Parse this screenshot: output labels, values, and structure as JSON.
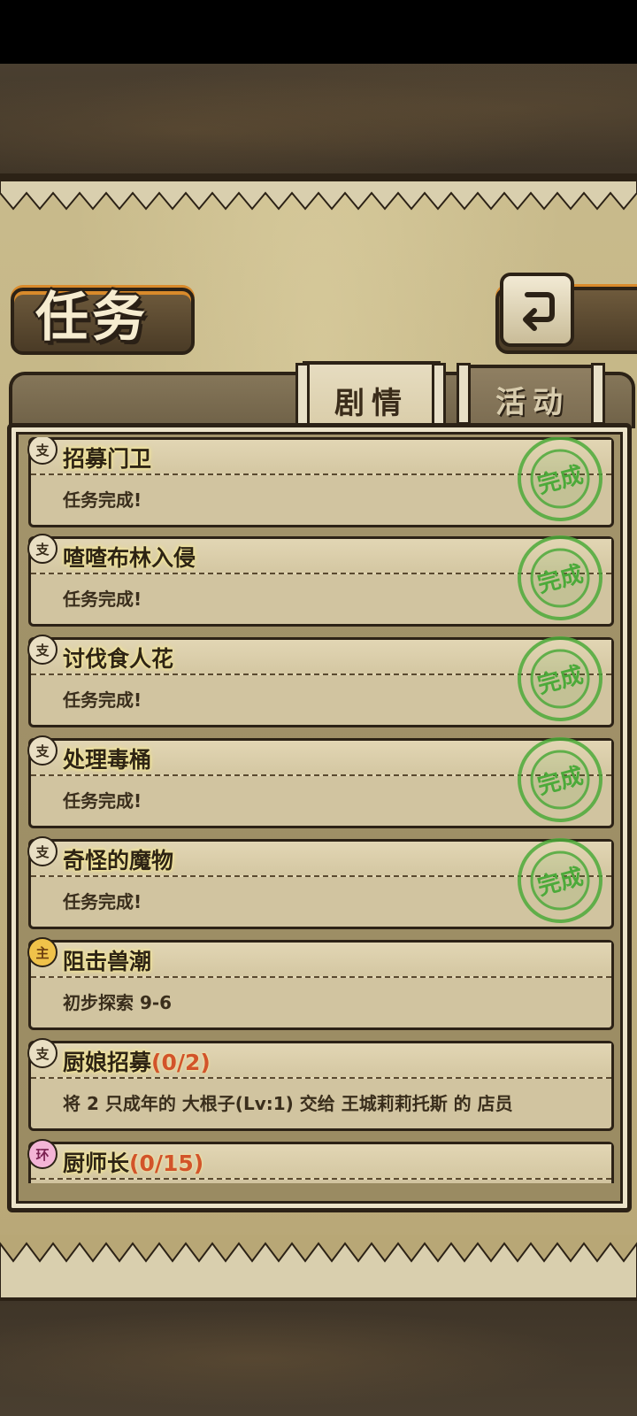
{
  "page_title": "任务",
  "tabs": [
    {
      "label": "剧情",
      "active": true
    },
    {
      "label": "活动",
      "active": false
    }
  ],
  "back_icon": "back-arrow-icon",
  "stamp": {
    "text": "完成",
    "ring_text": "Mission Complete Mission Complete",
    "color": "#4caa3a"
  },
  "quests": [
    {
      "badge": "支",
      "type": "side",
      "title": "招募门卫",
      "progress": "",
      "desc": "任务完成!",
      "completed": true
    },
    {
      "badge": "支",
      "type": "side",
      "title": "喳喳布林入侵",
      "progress": "",
      "desc": "任务完成!",
      "completed": true
    },
    {
      "badge": "支",
      "type": "side",
      "title": "讨伐食人花",
      "progress": "",
      "desc": "任务完成!",
      "completed": true
    },
    {
      "badge": "支",
      "type": "side",
      "title": "处理毒桶",
      "progress": "",
      "desc": "任务完成!",
      "completed": true
    },
    {
      "badge": "支",
      "type": "side",
      "title": "奇怪的魔物",
      "progress": "",
      "desc": "任务完成!",
      "completed": true
    },
    {
      "badge": "主",
      "type": "main",
      "title": "阻击兽潮",
      "progress": "",
      "desc": "初步探索 9-6",
      "completed": false
    },
    {
      "badge": "支",
      "type": "side",
      "title": "厨娘招募",
      "progress": "(0/2)",
      "desc": "将 2 只成年的 大根子(Lv:1) 交给 王城莉莉托斯 的 店员",
      "completed": false
    },
    {
      "badge": "环",
      "type": "daily",
      "title": "厨师长",
      "progress": "(0/15)",
      "desc": "",
      "completed": false
    }
  ]
}
